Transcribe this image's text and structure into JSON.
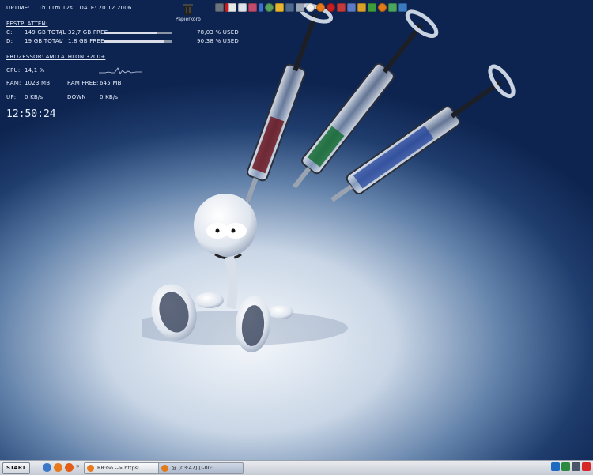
{
  "sysmon": {
    "uptime_label": "UPTIME:",
    "uptime_value": "1h 11m 12s",
    "date_label": "DATE:",
    "date_value": "20.12.2006",
    "festplatten_label": "FESTPLATTEN:",
    "drives": [
      {
        "letter": "C:",
        "total": "149 GB TOTAL",
        "slash": "/",
        "free": "32,7 GB FREE",
        "used": "78,03 % USED",
        "used_fraction": 0.7803
      },
      {
        "letter": "D:",
        "total": "19 GB TOTAL",
        "slash": "/",
        "free": "1,8 GB FREE",
        "used": "90,38 % USED",
        "used_fraction": 0.9038
      }
    ],
    "processor_label": "PROZESSOR: AMD ATHLON 3200+",
    "cpu_label": "CPU:",
    "cpu_value": "14,1 %",
    "ram_label": "RAM:",
    "ram_value": "1023 MB",
    "ramfree_label": "RAM FREE:",
    "ramfree_value": "645 MB",
    "up_label": "UP:",
    "up_value": "0 KB/s",
    "down_label": "DOWN",
    "down_value": "0 KB/s",
    "clock": "12:50:24"
  },
  "desktop": {
    "trash_label": "Papierkorb"
  },
  "taskbar": {
    "start_label": "START",
    "chevron": "»",
    "buttons": [
      {
        "label": "RR:Go --> https:..."
      },
      {
        "label": "@ [03:47] [:-00:..."
      }
    ]
  },
  "colors": {
    "text": "#e6eefc",
    "bg_dark": "#0e2450",
    "taskbar": "#c6cbd4"
  }
}
